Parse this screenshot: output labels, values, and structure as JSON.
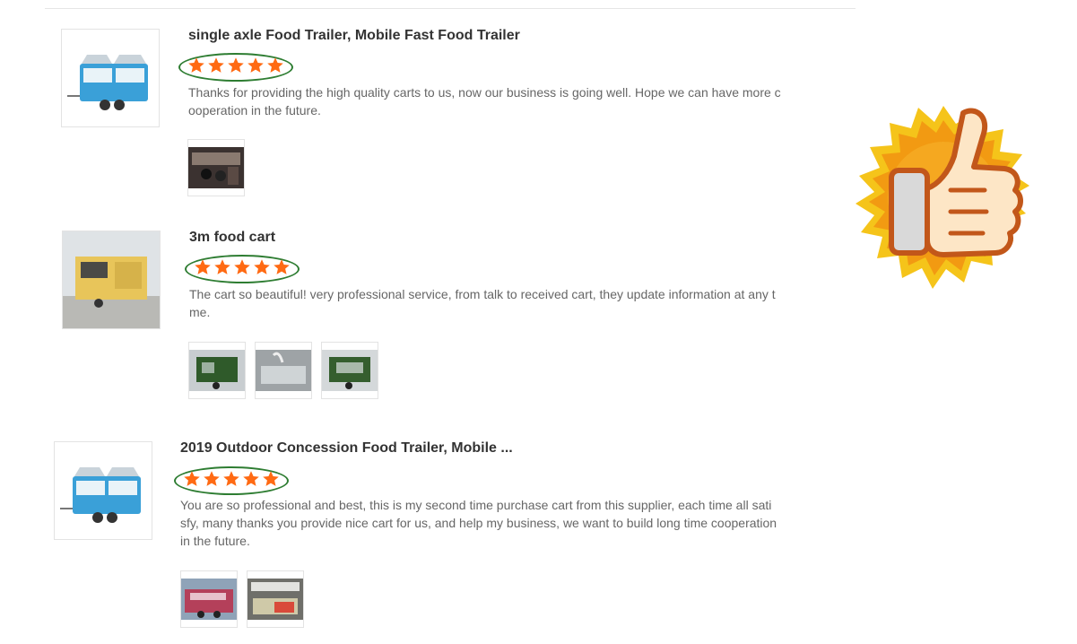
{
  "reviews": [
    {
      "title": "single axle Food Trailer, Mobile Fast Food Trailer",
      "rating": 5,
      "text": "Thanks for providing the high quality carts to us, now our business is going well. Hope we can have more c\nooperation in the future.",
      "photo_count": 1
    },
    {
      "title": "3m food cart",
      "rating": 5,
      "text": "The cart so beautiful! very professional service, from talk to received cart, they update information at any t\nme.",
      "photo_count": 3
    },
    {
      "title": "2019 Outdoor Concession Food Trailer, Mobile ...",
      "rating": 5,
      "text": "You are so professional and best, this is my second time purchase cart from this supplier, each time all sati\nsfy, many thanks you provide nice cart for us, and help my business, we want to build long time cooperation\nin the future.",
      "photo_count": 2
    }
  ],
  "colors": {
    "star": "#ff6a13",
    "rating_highlight": "#2e7d32",
    "trailer_blue": "#3aa0d8",
    "badge_gold": "#f5b21a"
  },
  "icons": {
    "rating": "star-icon",
    "badge": "thumbs-up-badge-icon"
  }
}
